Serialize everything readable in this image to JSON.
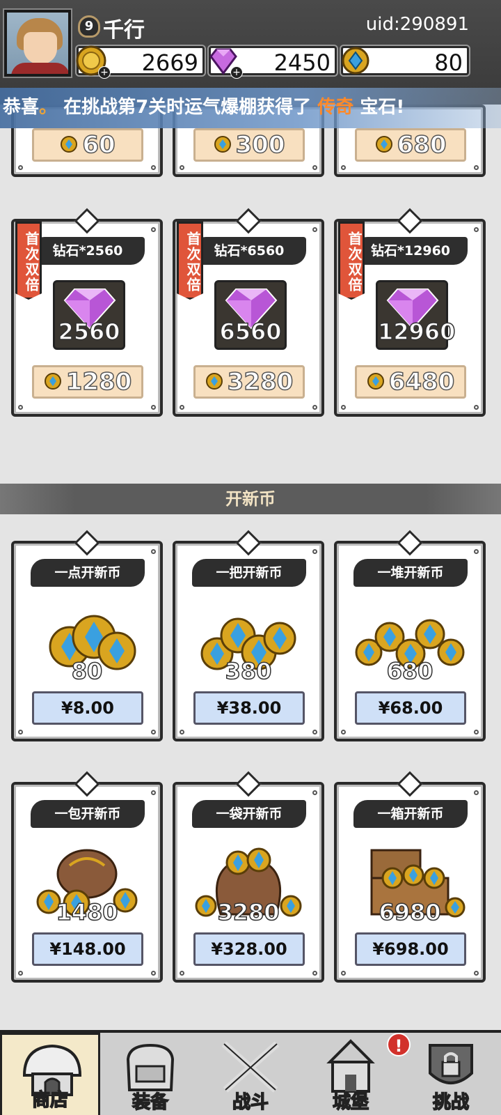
{
  "player": {
    "level": "9",
    "name": "千行",
    "uid": "uid:290891"
  },
  "resources": {
    "gold": "2669",
    "diamond": "2450",
    "newcoin": "80"
  },
  "announcement": {
    "prefix": "恭喜",
    "dot": "。",
    "middle": "在挑战第7关时运气爆棚获得了",
    "highlight": "传奇",
    "suffix": "宝石!"
  },
  "top_partial_row": {
    "prices": [
      "60",
      "300",
      "680"
    ]
  },
  "diamond_packs": [
    {
      "tag": "首次双倍",
      "title": "钻石*2560",
      "amount": "2560",
      "price": "1280"
    },
    {
      "tag": "首次双倍",
      "title": "钻石*6560",
      "amount": "6560",
      "price": "3280"
    },
    {
      "tag": "首次双倍",
      "title": "钻石*12960",
      "amount": "12960",
      "price": "6480"
    }
  ],
  "section_title": "开新币",
  "coin_packs": [
    {
      "title": "一点开新币",
      "amount": "80",
      "price": "¥8.00"
    },
    {
      "title": "一把开新币",
      "amount": "380",
      "price": "¥38.00"
    },
    {
      "title": "一堆开新币",
      "amount": "680",
      "price": "¥68.00"
    },
    {
      "title": "一包开新币",
      "amount": "1480",
      "price": "¥148.00"
    },
    {
      "title": "一袋开新币",
      "amount": "3280",
      "price": "¥328.00"
    },
    {
      "title": "一箱开新币",
      "amount": "6980",
      "price": "¥698.00"
    }
  ],
  "nav": [
    {
      "label": "商店",
      "icon": "shop-icon",
      "active": true
    },
    {
      "label": "装备",
      "icon": "backpack-icon",
      "active": false
    },
    {
      "label": "战斗",
      "icon": "crossed-swords-icon",
      "active": false
    },
    {
      "label": "城堡",
      "icon": "castle-icon",
      "active": false
    },
    {
      "label": "挑战",
      "icon": "locked-challenge-icon",
      "active": false
    }
  ],
  "notification": "!",
  "colors": {
    "topbar": "#3a3a3a",
    "announcement": "#5a86bf",
    "highlight": "#ff8a2a",
    "first_tag": "#e0553a",
    "price_blue": "#cfe0f7",
    "price_tan": "#f8e0c0"
  }
}
